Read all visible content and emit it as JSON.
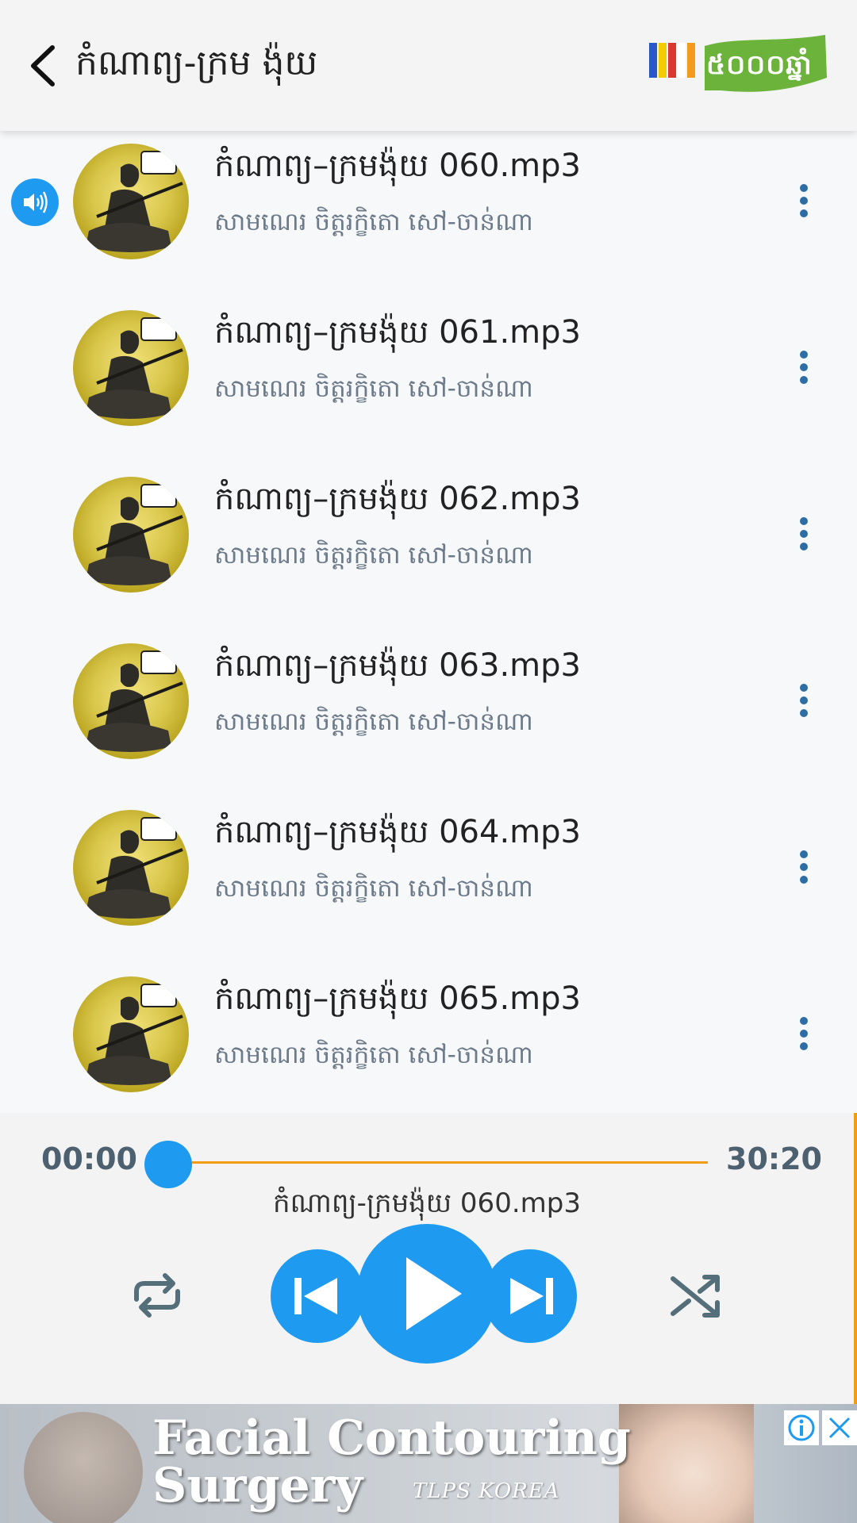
{
  "header": {
    "title": "កំណាព្យ-ក្រម ង៉ុយ",
    "logo_text": "៥០០០ឆ្នាំ"
  },
  "tracks": [
    {
      "title": "កំណាព្យ–ក្រមង៉ុយ 060.mp3",
      "artist": "សាមណេរ ចិត្តរក្ខិតោ សៅ-ចាន់ណា",
      "playing": true
    },
    {
      "title": "កំណាព្យ–ក្រមង៉ុយ 061.mp3",
      "artist": "សាមណេរ ចិត្តរក្ខិតោ សៅ-ចាន់ណា",
      "playing": false
    },
    {
      "title": "កំណាព្យ–ក្រមង៉ុយ 062.mp3",
      "artist": "សាមណេរ ចិត្តរក្ខិតោ សៅ-ចាន់ណា",
      "playing": false
    },
    {
      "title": "កំណាព្យ–ក្រមង៉ុយ 063.mp3",
      "artist": "សាមណេរ ចិត្តរក្ខិតោ សៅ-ចាន់ណា",
      "playing": false
    },
    {
      "title": "កំណាព្យ–ក្រមង៉ុយ 064.mp3",
      "artist": "សាមណេរ ចិត្តរក្ខិតោ សៅ-ចាន់ណា",
      "playing": false
    },
    {
      "title": "កំណាព្យ–ក្រមង៉ុយ 065.mp3",
      "artist": "សាមណេរ ចិត្តរក្ខិតោ សៅ-ចាន់ណា",
      "playing": false
    }
  ],
  "player": {
    "current_time": "00:00",
    "total_time": "30:20",
    "progress": 0,
    "now_playing": "កំណាព្យ-ក្រមង៉ុយ 060.mp3"
  },
  "ad": {
    "line1": "Facial Contouring",
    "line2": "Surgery",
    "brand": "TLPS KOREA"
  },
  "colors": {
    "accent": "#1e9bf0",
    "seek_track": "#f39c12",
    "menu_icon": "#2e6da4"
  },
  "icons": {
    "back": "chevron-left-icon",
    "speaker": "speaker-icon",
    "more": "more-vertical-icon",
    "repeat": "repeat-icon",
    "prev": "skip-previous-icon",
    "play": "play-icon",
    "next": "skip-next-icon",
    "shuffle": "shuffle-icon",
    "ad_info": "info-icon",
    "ad_close": "close-icon"
  }
}
